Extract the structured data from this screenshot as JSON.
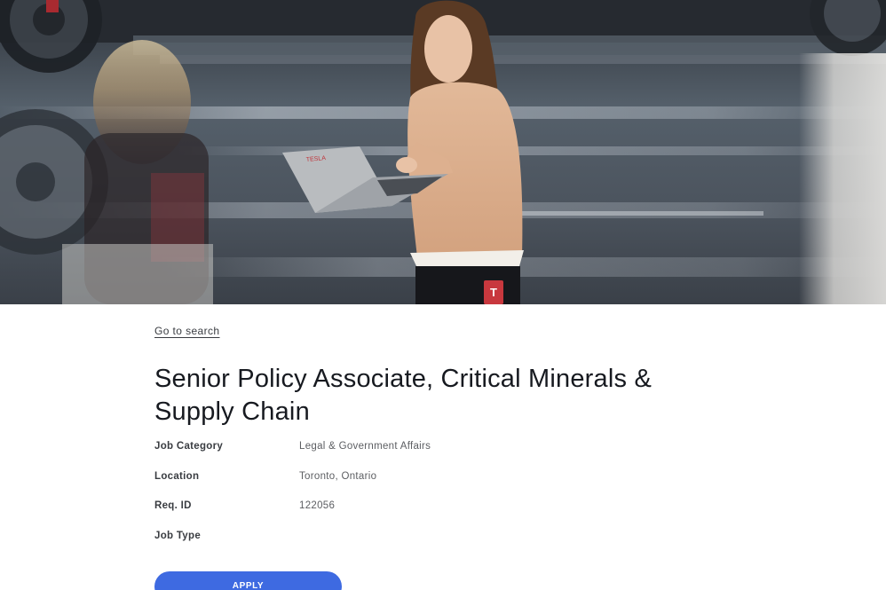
{
  "hero": {
    "image_subject": "Tesla employee with laptop walking past car",
    "laptop_brand_text": "TESLA"
  },
  "navigation": {
    "back_link_label": "Go to search"
  },
  "job": {
    "title": "Senior Policy Associate, Critical Minerals & Supply Chain",
    "details": [
      {
        "label": "Job Category",
        "value": "Legal & Government Affairs"
      },
      {
        "label": "Location",
        "value": "Toronto, Ontario"
      },
      {
        "label": "Req. ID",
        "value": "122056"
      },
      {
        "label": "Job Type",
        "value": ""
      }
    ]
  },
  "actions": {
    "apply_label": "APPLY"
  },
  "colors": {
    "accent": "#3e6ae1",
    "text_primary": "#171a20",
    "text_secondary": "#5c5e62"
  }
}
